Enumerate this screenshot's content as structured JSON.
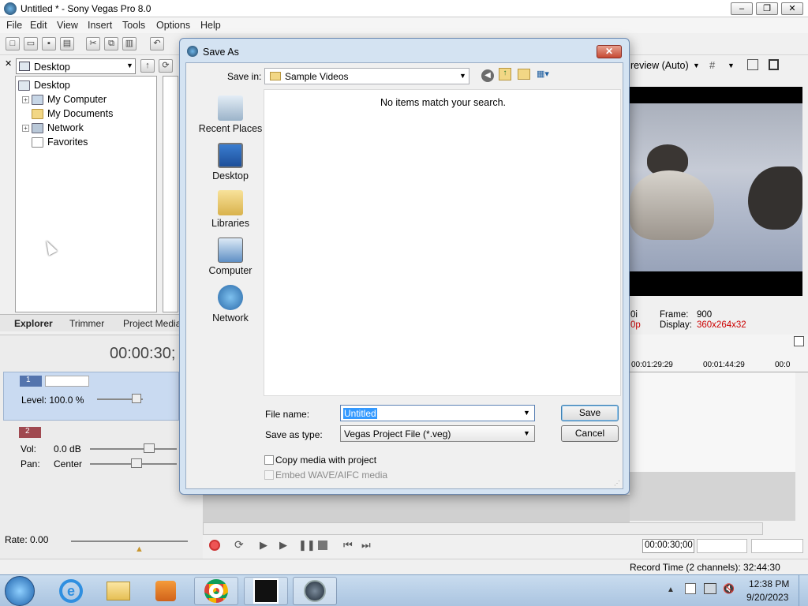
{
  "window": {
    "title": "Untitled * - Sony Vegas Pro 8.0"
  },
  "menu": [
    "File",
    "Edit",
    "View",
    "Insert",
    "Tools",
    "Options",
    "Help"
  ],
  "explorer": {
    "location": "Desktop",
    "tree": [
      "Desktop",
      "My Computer",
      "My Documents",
      "Network",
      "Favorites"
    ],
    "tabs": [
      "Explorer",
      "Trimmer",
      "Project Media"
    ]
  },
  "preview": {
    "mode": "review (Auto)",
    "frame_label": "Frame:",
    "frame_value": "900",
    "display_label": "Display:",
    "display_value": "360x264x32",
    "left_stub1": "0i",
    "left_stub2": "0p"
  },
  "timeline": {
    "timecode": "00:00:30;",
    "ruler": [
      "00:01:29:29",
      "00:01:44:29",
      "00:0"
    ],
    "video_track": {
      "number": "1",
      "level": "Level: 100.0 %"
    },
    "audio_track": {
      "number": "2",
      "vol_label": "Vol:",
      "vol_value": "0.0 dB",
      "pan_label": "Pan:",
      "pan_value": "Center"
    },
    "rate": "Rate: 0.00",
    "position": "00:00:30;00",
    "record_time": "Record Time (2 channels): 32:44:30"
  },
  "dialog": {
    "title": "Save As",
    "save_in_label": "Save in:",
    "save_in_value": "Sample Videos",
    "empty_message": "No items match your search.",
    "places": [
      "Recent Places",
      "Desktop",
      "Libraries",
      "Computer",
      "Network"
    ],
    "file_name_label": "File name:",
    "file_name_value": "Untitled",
    "save_type_label": "Save as type:",
    "save_type_value": "Vegas Project File (*.veg)",
    "save_button": "Save",
    "cancel_button": "Cancel",
    "copy_media": "Copy media with project",
    "embed_media": "Embed WAVE/AIFC media"
  },
  "taskbar": {
    "time": "12:38 PM",
    "date": "9/20/2023"
  }
}
